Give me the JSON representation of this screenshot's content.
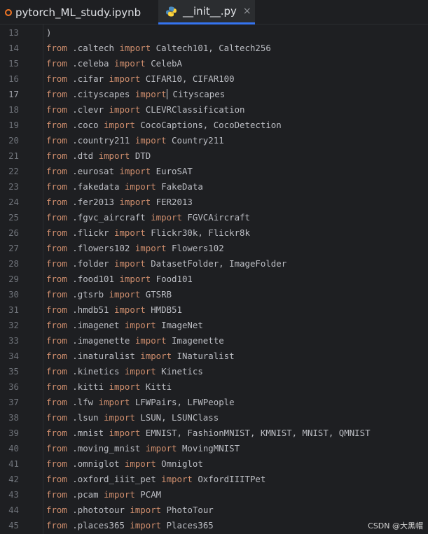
{
  "tabs": [
    {
      "label": "pytorch_ML_study.ipynb",
      "icon": "jupyter-notebook-icon",
      "active": false
    },
    {
      "label": "__init__.py",
      "icon": "python-file-icon",
      "active": true,
      "close": "×"
    }
  ],
  "editor": {
    "current_line": "17",
    "lines": [
      {
        "num": "13",
        "text": ")"
      },
      {
        "num": "14",
        "kw1": "from",
        "mod": " .caltech ",
        "kw2": "import",
        "names": " Caltech101, Caltech256"
      },
      {
        "num": "15",
        "kw1": "from",
        "mod": " .celeba ",
        "kw2": "import",
        "names": " CelebA"
      },
      {
        "num": "16",
        "kw1": "from",
        "mod": " .cifar ",
        "kw2": "import",
        "names": " CIFAR10, CIFAR100"
      },
      {
        "num": "17",
        "kw1": "from",
        "mod": " .cityscapes ",
        "kw2": "import",
        "names": " Cityscapes",
        "caret": true
      },
      {
        "num": "18",
        "kw1": "from",
        "mod": " .clevr ",
        "kw2": "import",
        "names": " CLEVRClassification"
      },
      {
        "num": "19",
        "kw1": "from",
        "mod": " .coco ",
        "kw2": "import",
        "names": " CocoCaptions, CocoDetection"
      },
      {
        "num": "20",
        "kw1": "from",
        "mod": " .country211 ",
        "kw2": "import",
        "names": " Country211"
      },
      {
        "num": "21",
        "kw1": "from",
        "mod": " .dtd ",
        "kw2": "import",
        "names": " DTD"
      },
      {
        "num": "22",
        "kw1": "from",
        "mod": " .eurosat ",
        "kw2": "import",
        "names": " EuroSAT"
      },
      {
        "num": "23",
        "kw1": "from",
        "mod": " .fakedata ",
        "kw2": "import",
        "names": " FakeData"
      },
      {
        "num": "24",
        "kw1": "from",
        "mod": " .fer2013 ",
        "kw2": "import",
        "names": " FER2013"
      },
      {
        "num": "25",
        "kw1": "from",
        "mod": " .fgvc_aircraft ",
        "kw2": "import",
        "names": " FGVCAircraft"
      },
      {
        "num": "26",
        "kw1": "from",
        "mod": " .flickr ",
        "kw2": "import",
        "names": " Flickr30k, Flickr8k"
      },
      {
        "num": "27",
        "kw1": "from",
        "mod": " .flowers102 ",
        "kw2": "import",
        "names": " Flowers102"
      },
      {
        "num": "28",
        "kw1": "from",
        "mod": " .folder ",
        "kw2": "import",
        "names": " DatasetFolder, ImageFolder"
      },
      {
        "num": "29",
        "kw1": "from",
        "mod": " .food101 ",
        "kw2": "import",
        "names": " Food101"
      },
      {
        "num": "30",
        "kw1": "from",
        "mod": " .gtsrb ",
        "kw2": "import",
        "names": " GTSRB"
      },
      {
        "num": "31",
        "kw1": "from",
        "mod": " .hmdb51 ",
        "kw2": "import",
        "names": " HMDB51"
      },
      {
        "num": "32",
        "kw1": "from",
        "mod": " .imagenet ",
        "kw2": "import",
        "names": " ImageNet"
      },
      {
        "num": "33",
        "kw1": "from",
        "mod": " .imagenette ",
        "kw2": "import",
        "names": " Imagenette"
      },
      {
        "num": "34",
        "kw1": "from",
        "mod": " .inaturalist ",
        "kw2": "import",
        "names": " INaturalist"
      },
      {
        "num": "35",
        "kw1": "from",
        "mod": " .kinetics ",
        "kw2": "import",
        "names": " Kinetics"
      },
      {
        "num": "36",
        "kw1": "from",
        "mod": " .kitti ",
        "kw2": "import",
        "names": " Kitti"
      },
      {
        "num": "37",
        "kw1": "from",
        "mod": " .lfw ",
        "kw2": "import",
        "names": " LFWPairs, LFWPeople"
      },
      {
        "num": "38",
        "kw1": "from",
        "mod": " .lsun ",
        "kw2": "import",
        "names": " LSUN, LSUNClass"
      },
      {
        "num": "39",
        "kw1": "from",
        "mod": " .mnist ",
        "kw2": "import",
        "names": " EMNIST, FashionMNIST, KMNIST, MNIST, QMNIST"
      },
      {
        "num": "40",
        "kw1": "from",
        "mod": " .moving_mnist ",
        "kw2": "import",
        "names": " MovingMNIST"
      },
      {
        "num": "41",
        "kw1": "from",
        "mod": " .omniglot ",
        "kw2": "import",
        "names": " Omniglot"
      },
      {
        "num": "42",
        "kw1": "from",
        "mod": " .oxford_iiit_pet ",
        "kw2": "import",
        "names": " OxfordIIITPet"
      },
      {
        "num": "43",
        "kw1": "from",
        "mod": " .pcam ",
        "kw2": "import",
        "names": " PCAM"
      },
      {
        "num": "44",
        "kw1": "from",
        "mod": " .phototour ",
        "kw2": "import",
        "names": " PhotoTour"
      },
      {
        "num": "45",
        "kw1": "from",
        "mod": " .places365 ",
        "kw2": "import",
        "names": " Places365"
      }
    ]
  },
  "watermark": "CSDN @大黑帽",
  "colors": {
    "background": "#1e1f22",
    "keyword": "#cf8e6d",
    "text": "#bcbec4",
    "line_number": "#6f737a",
    "active_tab_underline": "#3574f0"
  }
}
